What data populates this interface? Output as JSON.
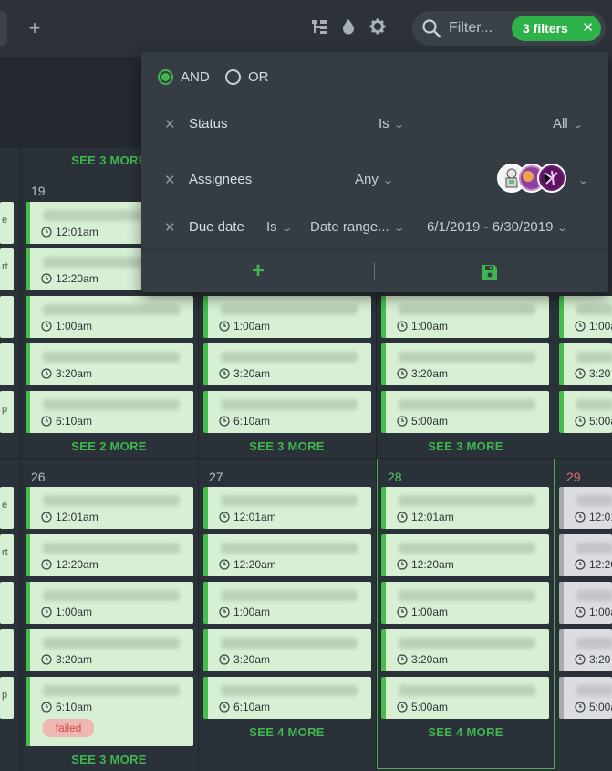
{
  "toolbar": {
    "add_label": "+",
    "filter_placeholder": "Filter...",
    "filter_count_label": "3 filters",
    "clear_label": "✕"
  },
  "filter_panel": {
    "logic": {
      "and_label": "AND",
      "or_label": "OR",
      "selected": "AND"
    },
    "rows": [
      {
        "field": "Status",
        "operator": "Is",
        "value": "All"
      },
      {
        "field": "Assignees",
        "operator": "Any",
        "value": ""
      },
      {
        "field": "Due date",
        "operator": "Is",
        "mode": "Date range...",
        "value": "6/1/2019 - 6/30/2019"
      }
    ],
    "remove_label": "✕",
    "add_label": "+"
  },
  "calendar": {
    "top_see_more": "SEE 3 MORE",
    "row1": {
      "days": [
        "19"
      ],
      "see_more": [
        "SEE 2 MORE",
        "SEE 3 MORE",
        "SEE 3 MORE"
      ]
    },
    "row2": {
      "days": [
        "26",
        "27",
        "28",
        "29"
      ],
      "see_more": [
        "SEE 3 MORE",
        "SEE 4 MORE",
        "SEE 4 MORE"
      ]
    },
    "times": {
      "t1201": "12:01am",
      "t1220": "12:20am",
      "t100": "1:00am",
      "t320": "3:20am",
      "t610": "6:10am",
      "t500": "5:00am",
      "c1201": "12:01",
      "c1220": "12:20",
      "c100": "1:00a",
      "c320": "3:20",
      "c500": "5:00a"
    },
    "failed_label": "failed",
    "fragments": {
      "e": "e",
      "rt": "rt",
      "p": "p"
    }
  }
}
